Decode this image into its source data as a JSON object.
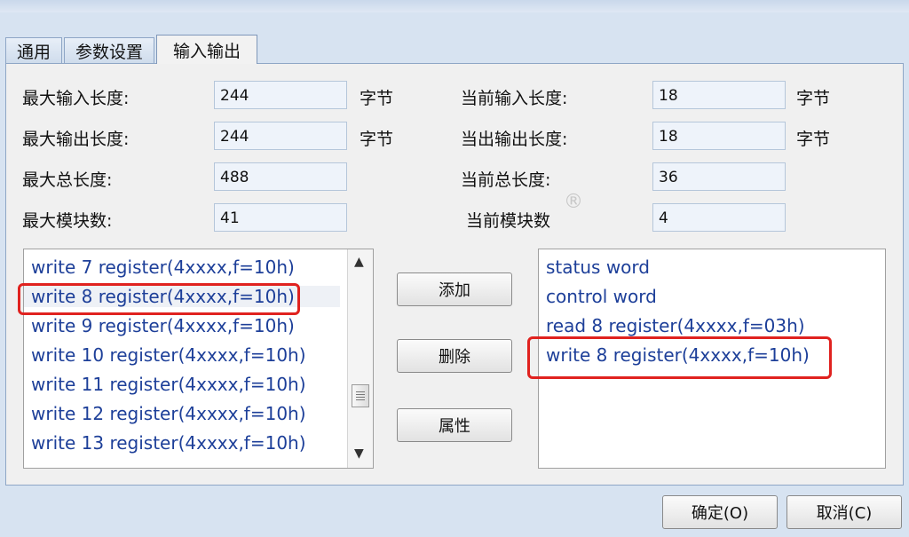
{
  "tabs": [
    "通用",
    "参数设置",
    "输入输出"
  ],
  "fields": {
    "max_input_label": "最大输入长度:",
    "max_input_value": "244",
    "max_input_unit": "字节",
    "max_output_label": "最大输出长度:",
    "max_output_value": "244",
    "max_output_unit": "字节",
    "max_total_label": "最大总长度:",
    "max_total_value": "488",
    "max_modules_label": "最大模块数:",
    "max_modules_value": "41",
    "cur_input_label": "当前输入长度:",
    "cur_input_value": "18",
    "cur_input_unit": "字节",
    "cur_output_label": "当出输出长度:",
    "cur_output_value": "18",
    "cur_output_unit": "字节",
    "cur_total_label": "当前总长度:",
    "cur_total_value": "36",
    "cur_modules_label": "当前模块数",
    "cur_modules_value": "4"
  },
  "available_modules": [
    "write 7 register(4xxxx,f=10h)",
    "write 8 register(4xxxx,f=10h)",
    "write 9 register(4xxxx,f=10h)",
    "write 10 register(4xxxx,f=10h)",
    "write 11 register(4xxxx,f=10h)",
    "write 12 register(4xxxx,f=10h)",
    "write 13 register(4xxxx,f=10h)"
  ],
  "selected_modules": [
    "status word",
    "control word",
    "read 8 register(4xxxx,f=03h)",
    "write 8 register(4xxxx,f=10h)"
  ],
  "buttons": {
    "add": "添加",
    "delete": "删除",
    "properties": "属性",
    "ok": "确定(O)",
    "cancel": "取消(C)"
  },
  "watermark": "®",
  "colors": {
    "list_text": "#1d3f99",
    "highlight": "#e0221f"
  }
}
